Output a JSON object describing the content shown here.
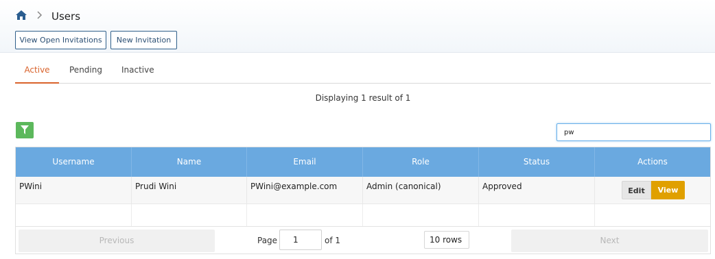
{
  "header": {
    "breadcrumb_icon": "home-icon",
    "separator_icon": "chevron-right-icon",
    "title": "Users",
    "buttons": {
      "open_invitations": "View Open Invitations",
      "new_invitation": "New Invitation"
    }
  },
  "tabs": [
    {
      "label": "Active",
      "active": true
    },
    {
      "label": "Pending",
      "active": false
    },
    {
      "label": "Inactive",
      "active": false
    }
  ],
  "result_count": "Displaying 1 result of 1",
  "filter": {
    "icon": "filter-icon"
  },
  "search": {
    "value": "pw",
    "placeholder": ""
  },
  "table": {
    "columns": [
      "Username",
      "Name",
      "Email",
      "Role",
      "Status",
      "Actions"
    ],
    "rows": [
      {
        "username": "PWini",
        "name": "Prudi Wini",
        "email": "PWini@example.com",
        "role": "Admin (canonical)",
        "status": "Approved",
        "actions": {
          "edit": "Edit",
          "view": "View"
        }
      }
    ]
  },
  "pagination": {
    "previous": "Previous",
    "page_label": "Page",
    "page_value": "1",
    "of_label": "of 1",
    "rows_per_page": "10 rows",
    "next": "Next"
  },
  "colors": {
    "accent": "#d9622b",
    "header_row": "#6aa9e0",
    "filter_button": "#5cb85c",
    "view_button": "#e0a000",
    "outline_button": "#2f5f8a"
  }
}
